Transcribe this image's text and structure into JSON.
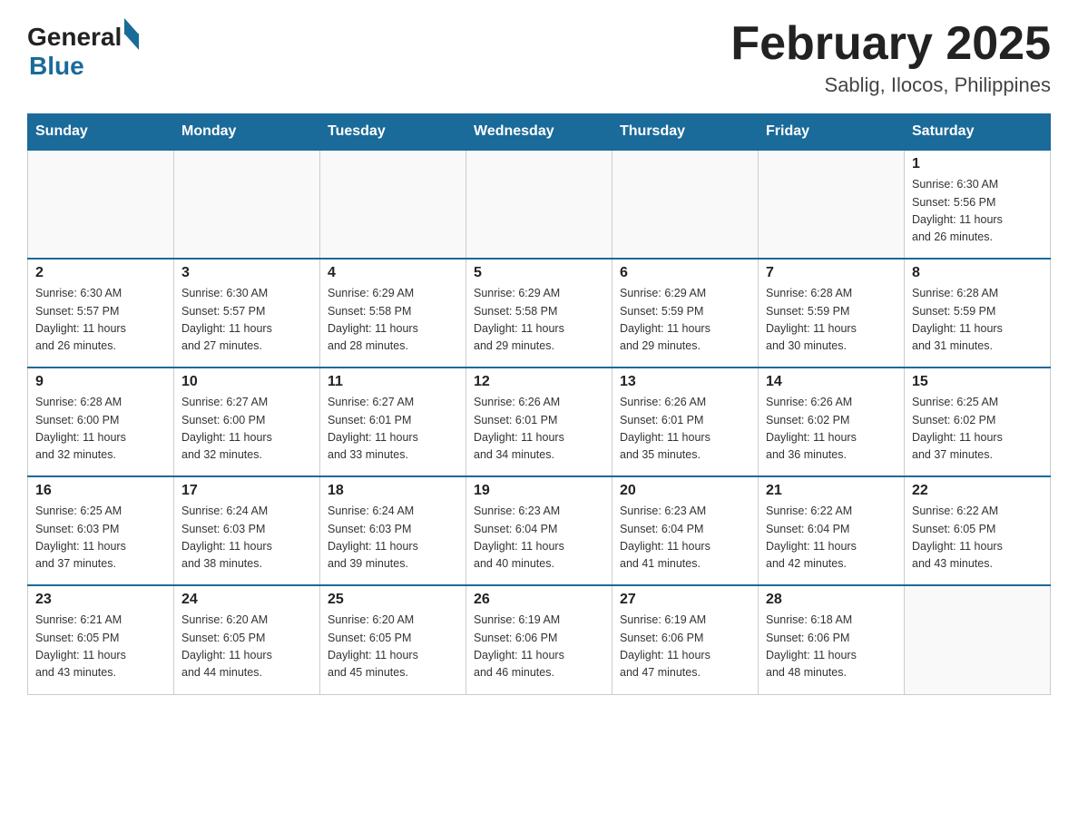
{
  "header": {
    "logo_general": "General",
    "logo_blue": "Blue",
    "month_title": "February 2025",
    "location": "Sablig, Ilocos, Philippines"
  },
  "weekdays": [
    "Sunday",
    "Monday",
    "Tuesday",
    "Wednesday",
    "Thursday",
    "Friday",
    "Saturday"
  ],
  "weeks": [
    [
      {
        "day": "",
        "info": ""
      },
      {
        "day": "",
        "info": ""
      },
      {
        "day": "",
        "info": ""
      },
      {
        "day": "",
        "info": ""
      },
      {
        "day": "",
        "info": ""
      },
      {
        "day": "",
        "info": ""
      },
      {
        "day": "1",
        "info": "Sunrise: 6:30 AM\nSunset: 5:56 PM\nDaylight: 11 hours\nand 26 minutes."
      }
    ],
    [
      {
        "day": "2",
        "info": "Sunrise: 6:30 AM\nSunset: 5:57 PM\nDaylight: 11 hours\nand 26 minutes."
      },
      {
        "day": "3",
        "info": "Sunrise: 6:30 AM\nSunset: 5:57 PM\nDaylight: 11 hours\nand 27 minutes."
      },
      {
        "day": "4",
        "info": "Sunrise: 6:29 AM\nSunset: 5:58 PM\nDaylight: 11 hours\nand 28 minutes."
      },
      {
        "day": "5",
        "info": "Sunrise: 6:29 AM\nSunset: 5:58 PM\nDaylight: 11 hours\nand 29 minutes."
      },
      {
        "day": "6",
        "info": "Sunrise: 6:29 AM\nSunset: 5:59 PM\nDaylight: 11 hours\nand 29 minutes."
      },
      {
        "day": "7",
        "info": "Sunrise: 6:28 AM\nSunset: 5:59 PM\nDaylight: 11 hours\nand 30 minutes."
      },
      {
        "day": "8",
        "info": "Sunrise: 6:28 AM\nSunset: 5:59 PM\nDaylight: 11 hours\nand 31 minutes."
      }
    ],
    [
      {
        "day": "9",
        "info": "Sunrise: 6:28 AM\nSunset: 6:00 PM\nDaylight: 11 hours\nand 32 minutes."
      },
      {
        "day": "10",
        "info": "Sunrise: 6:27 AM\nSunset: 6:00 PM\nDaylight: 11 hours\nand 32 minutes."
      },
      {
        "day": "11",
        "info": "Sunrise: 6:27 AM\nSunset: 6:01 PM\nDaylight: 11 hours\nand 33 minutes."
      },
      {
        "day": "12",
        "info": "Sunrise: 6:26 AM\nSunset: 6:01 PM\nDaylight: 11 hours\nand 34 minutes."
      },
      {
        "day": "13",
        "info": "Sunrise: 6:26 AM\nSunset: 6:01 PM\nDaylight: 11 hours\nand 35 minutes."
      },
      {
        "day": "14",
        "info": "Sunrise: 6:26 AM\nSunset: 6:02 PM\nDaylight: 11 hours\nand 36 minutes."
      },
      {
        "day": "15",
        "info": "Sunrise: 6:25 AM\nSunset: 6:02 PM\nDaylight: 11 hours\nand 37 minutes."
      }
    ],
    [
      {
        "day": "16",
        "info": "Sunrise: 6:25 AM\nSunset: 6:03 PM\nDaylight: 11 hours\nand 37 minutes."
      },
      {
        "day": "17",
        "info": "Sunrise: 6:24 AM\nSunset: 6:03 PM\nDaylight: 11 hours\nand 38 minutes."
      },
      {
        "day": "18",
        "info": "Sunrise: 6:24 AM\nSunset: 6:03 PM\nDaylight: 11 hours\nand 39 minutes."
      },
      {
        "day": "19",
        "info": "Sunrise: 6:23 AM\nSunset: 6:04 PM\nDaylight: 11 hours\nand 40 minutes."
      },
      {
        "day": "20",
        "info": "Sunrise: 6:23 AM\nSunset: 6:04 PM\nDaylight: 11 hours\nand 41 minutes."
      },
      {
        "day": "21",
        "info": "Sunrise: 6:22 AM\nSunset: 6:04 PM\nDaylight: 11 hours\nand 42 minutes."
      },
      {
        "day": "22",
        "info": "Sunrise: 6:22 AM\nSunset: 6:05 PM\nDaylight: 11 hours\nand 43 minutes."
      }
    ],
    [
      {
        "day": "23",
        "info": "Sunrise: 6:21 AM\nSunset: 6:05 PM\nDaylight: 11 hours\nand 43 minutes."
      },
      {
        "day": "24",
        "info": "Sunrise: 6:20 AM\nSunset: 6:05 PM\nDaylight: 11 hours\nand 44 minutes."
      },
      {
        "day": "25",
        "info": "Sunrise: 6:20 AM\nSunset: 6:05 PM\nDaylight: 11 hours\nand 45 minutes."
      },
      {
        "day": "26",
        "info": "Sunrise: 6:19 AM\nSunset: 6:06 PM\nDaylight: 11 hours\nand 46 minutes."
      },
      {
        "day": "27",
        "info": "Sunrise: 6:19 AM\nSunset: 6:06 PM\nDaylight: 11 hours\nand 47 minutes."
      },
      {
        "day": "28",
        "info": "Sunrise: 6:18 AM\nSunset: 6:06 PM\nDaylight: 11 hours\nand 48 minutes."
      },
      {
        "day": "",
        "info": ""
      }
    ]
  ]
}
